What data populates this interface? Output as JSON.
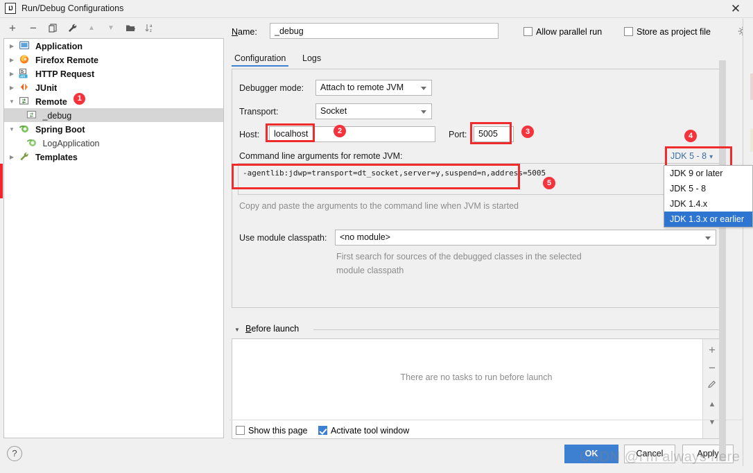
{
  "window": {
    "title": "Run/Debug Configurations",
    "logo_text": "IJ",
    "close_icon": "close-icon"
  },
  "left_toolbar": {
    "items": [
      {
        "name": "add-button",
        "glyph": "+"
      },
      {
        "name": "remove-button",
        "glyph": "−"
      },
      {
        "name": "copy-button",
        "glyph": "copy"
      },
      {
        "name": "edit-templates-button",
        "glyph": "wrench"
      },
      {
        "name": "move-up-button",
        "glyph": "▲"
      },
      {
        "name": "move-down-button",
        "glyph": "▼"
      },
      {
        "name": "new-folder-button",
        "glyph": "folder"
      },
      {
        "name": "sort-button",
        "glyph": "sort"
      }
    ]
  },
  "tree": {
    "items": [
      {
        "label": "Application",
        "twisty": "▶",
        "icon": "application-icon",
        "bold": true,
        "indent": 0,
        "badge": null,
        "selected": false
      },
      {
        "label": "Firefox Remote",
        "twisty": "▶",
        "icon": "firefox-icon",
        "bold": true,
        "indent": 0,
        "badge": null,
        "selected": false
      },
      {
        "label": "HTTP Request",
        "twisty": "▶",
        "icon": "http-request-icon",
        "bold": true,
        "indent": 0,
        "badge": null,
        "selected": false
      },
      {
        "label": "JUnit",
        "twisty": "▶",
        "icon": "junit-icon",
        "bold": true,
        "indent": 0,
        "badge": null,
        "selected": false
      },
      {
        "label": "Remote",
        "twisty": "▼",
        "icon": "remote-icon",
        "bold": true,
        "indent": 0,
        "badge": "1",
        "selected": false
      },
      {
        "label": "_debug",
        "twisty": "",
        "icon": "remote-icon",
        "bold": false,
        "indent": 1,
        "badge": null,
        "selected": true
      },
      {
        "label": "Spring Boot",
        "twisty": "▼",
        "icon": "spring-icon",
        "bold": true,
        "indent": 0,
        "badge": null,
        "selected": false
      },
      {
        "label": "LogApplication",
        "twisty": "",
        "icon": "spring-icon",
        "bold": false,
        "indent": 1,
        "badge": null,
        "selected": false
      },
      {
        "label": "Templates",
        "twisty": "▶",
        "icon": "wrench-icon",
        "bold": true,
        "indent": 0,
        "badge": null,
        "selected": false
      }
    ]
  },
  "help_button": {
    "label": "?"
  },
  "name_field": {
    "label": "Name:",
    "value": "_debug",
    "placeholder": ""
  },
  "top_checkboxes": [
    {
      "label": "Allow parallel run",
      "checked": false
    },
    {
      "label": "Store as project file",
      "checked": false
    }
  ],
  "settings_gear": "gear-icon",
  "tabs": [
    {
      "label": "Configuration",
      "active": true
    },
    {
      "label": "Logs",
      "active": false
    }
  ],
  "configuration": {
    "debugger_mode": {
      "label": "Debugger mode:",
      "value": "Attach to remote JVM"
    },
    "transport": {
      "label": "Transport:",
      "value": "Socket"
    },
    "host": {
      "label": "Host:",
      "value": "localhost"
    },
    "port": {
      "label": "Port:",
      "value": "5005"
    },
    "command_line": {
      "label": "Command line arguments for remote JVM:",
      "value": "-agentlib:jdwp=transport=dt_socket,server=y,suspend=n,address=5005",
      "hint": "Copy and paste the arguments to the command line when JVM is started"
    },
    "jdk_selector": {
      "value": "JDK 5 - 8",
      "chevron": "chevron-down-icon",
      "options": [
        {
          "label": "JDK 9 or later",
          "selected": false
        },
        {
          "label": "JDK 5 - 8",
          "selected": false
        },
        {
          "label": "JDK 1.4.x",
          "selected": false
        },
        {
          "label": "JDK 1.3.x or earlier",
          "selected": true
        }
      ]
    },
    "module_classpath": {
      "label": "Use module classpath:",
      "value": "<no module>",
      "hint_line1": "First search for sources of the debugged classes in the selected",
      "hint_line2": "module classpath"
    }
  },
  "before_launch": {
    "title": "Before launch",
    "twisty": "▼",
    "empty_text": "There are no tasks to run before launch",
    "side_buttons": [
      {
        "name": "add-task-button",
        "glyph": "+"
      },
      {
        "name": "remove-task-button",
        "glyph": "−"
      },
      {
        "name": "edit-task-button",
        "glyph": "pencil"
      },
      {
        "name": "move-task-up-button",
        "glyph": "▲"
      },
      {
        "name": "move-task-down-button",
        "glyph": "▼"
      }
    ]
  },
  "bottom_checkboxes": [
    {
      "label": "Show this page",
      "checked": false
    },
    {
      "label": "Activate tool window",
      "checked": true
    }
  ],
  "buttons": {
    "ok": "OK",
    "cancel": "Cancel",
    "apply": "Apply"
  },
  "annotations": {
    "badges": [
      "1",
      "2",
      "3",
      "4",
      "5"
    ]
  },
  "watermark": "CSDN @I'm always here",
  "colors": {
    "accent": "#3d7fd1",
    "annotation_red": "#ef2b2b",
    "badge_red": "#f4333d",
    "selection_blue": "#2d75d1",
    "panel_bg": "#f0f0f0"
  }
}
